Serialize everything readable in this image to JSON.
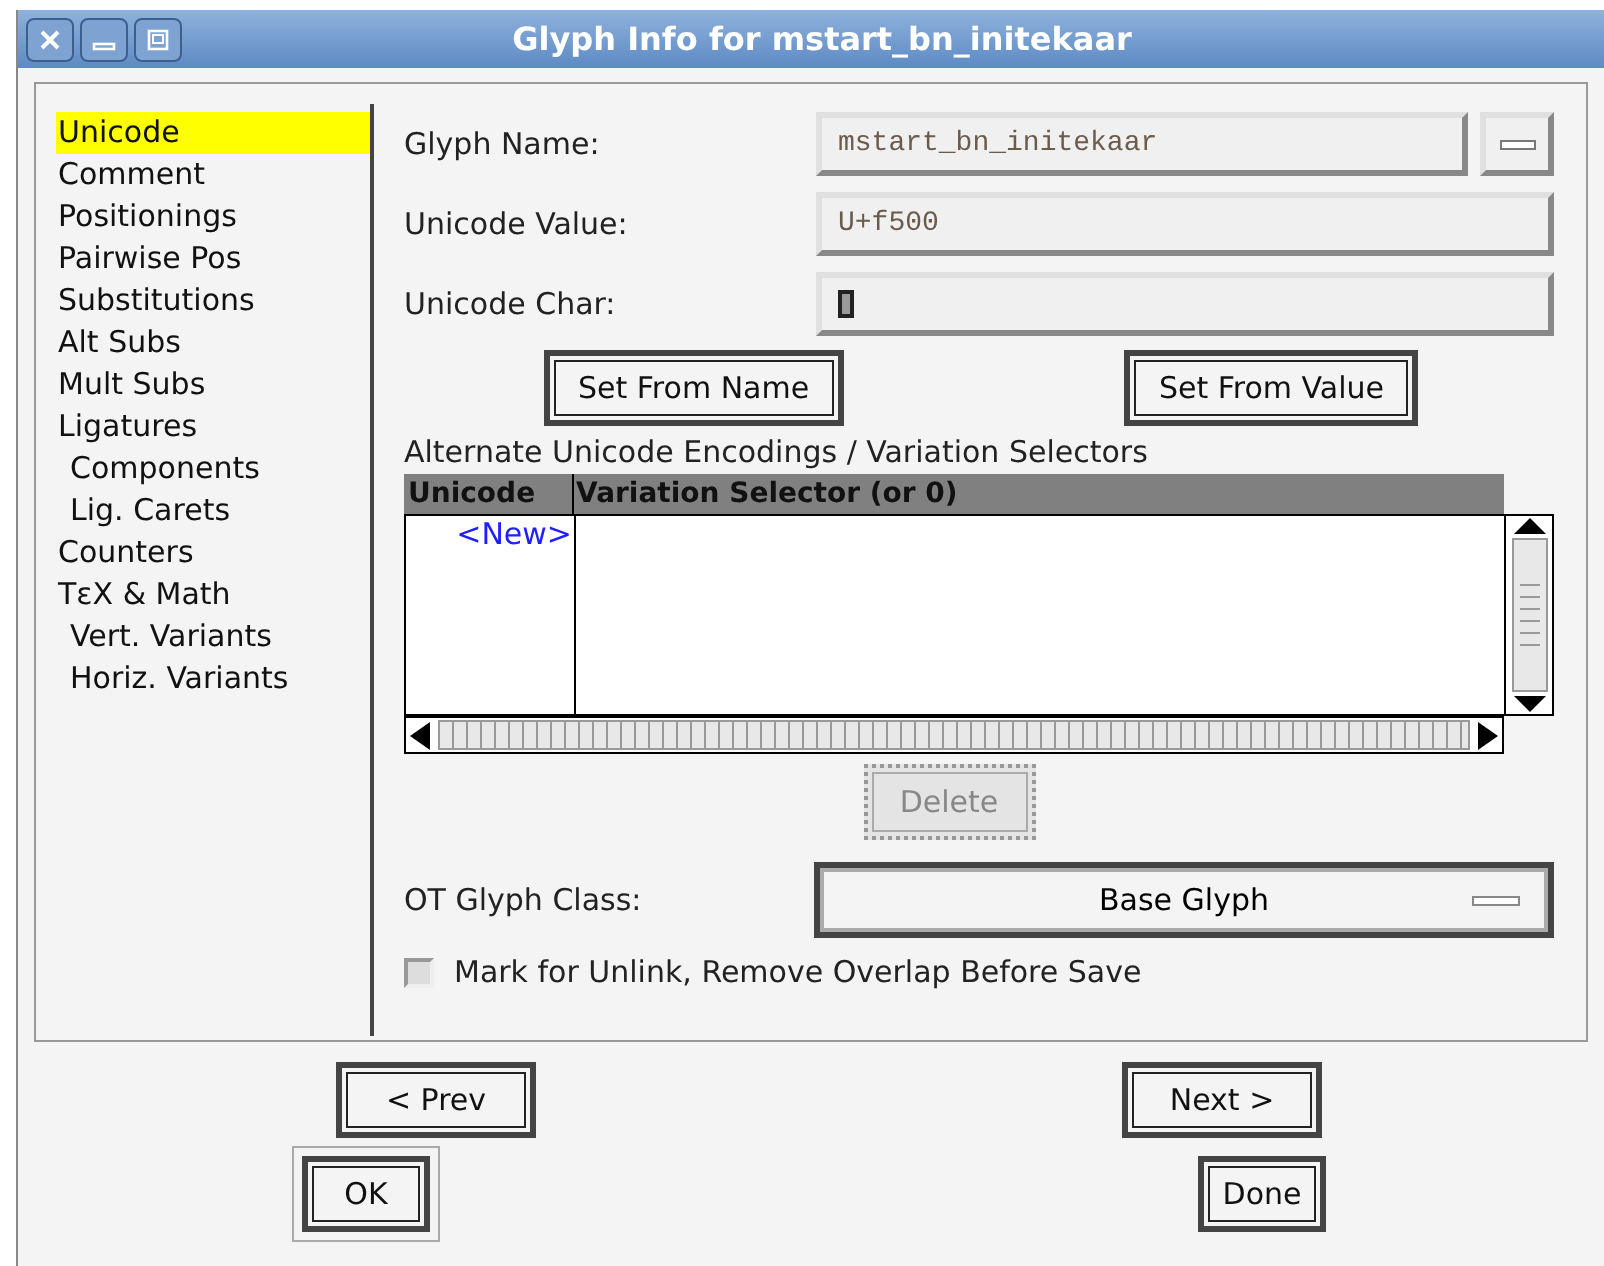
{
  "window": {
    "title": "Glyph Info for mstart_bn_initekaar"
  },
  "sidebar": {
    "items": [
      {
        "label": "Unicode",
        "selected": true
      },
      {
        "label": "Comment",
        "selected": false
      },
      {
        "label": "Positionings",
        "selected": false
      },
      {
        "label": "Pairwise Pos",
        "selected": false
      },
      {
        "label": "Substitutions",
        "selected": false
      },
      {
        "label": "Alt Subs",
        "selected": false
      },
      {
        "label": "Mult Subs",
        "selected": false
      },
      {
        "label": "Ligatures",
        "selected": false,
        "children": [
          {
            "label": "Components",
            "selected": false
          },
          {
            "label": "Lig. Carets",
            "selected": false
          }
        ]
      },
      {
        "label": "Counters",
        "selected": false
      },
      {
        "label": "TεX & Math",
        "selected": false,
        "children": [
          {
            "label": "Vert. Variants",
            "selected": false
          },
          {
            "label": "Horiz. Variants",
            "selected": false
          }
        ]
      }
    ]
  },
  "fields": [
    {
      "kind": "name",
      "label": "Glyph Name:",
      "value": "mstart_bn_initekaar"
    },
    {
      "kind": "value",
      "label": "Unicode Value:",
      "value": "U+f500"
    },
    {
      "kind": "char",
      "label": "Unicode Char:"
    }
  ],
  "set_buttons": [
    {
      "label": "Set From Name"
    },
    {
      "label": "Set From Value"
    }
  ],
  "alternates": {
    "title": "Alternate Unicode Encodings / Variation Selectors",
    "columns": [
      "Unicode",
      "Variation Selector (or 0)"
    ],
    "rows": [
      {
        "kind": "new",
        "unicode": "<New>"
      }
    ],
    "delete": {
      "label": "Delete",
      "disabled": true
    }
  },
  "glyph_class": {
    "label": "OT Glyph Class:",
    "value": "Base Glyph"
  },
  "unlink_checkbox": {
    "label": "Mark for Unlink, Remove Overlap Before Save",
    "checked": false
  },
  "nav_buttons": [
    {
      "label": "< Prev"
    },
    {
      "label": "Next >"
    }
  ],
  "buttons": [
    {
      "label": "OK",
      "default": true
    },
    {
      "label": "Done",
      "default": false
    }
  ]
}
